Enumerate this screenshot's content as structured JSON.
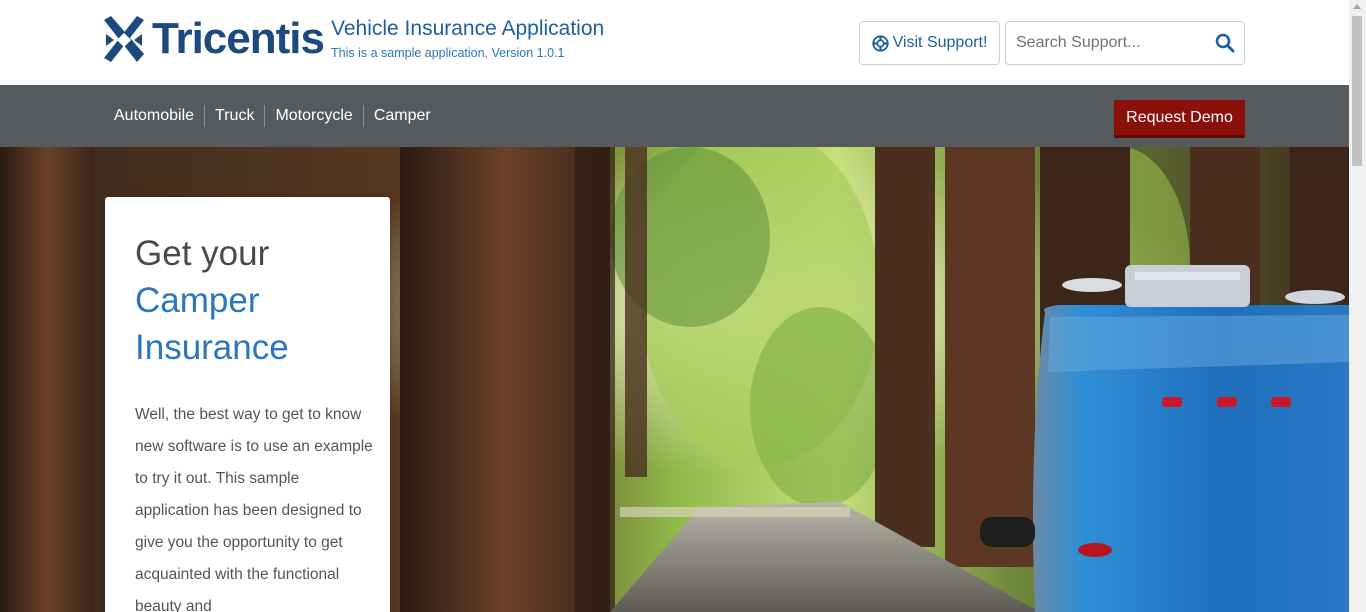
{
  "header": {
    "logo_text": "Tricentis",
    "app_title": "Vehicle Insurance Application",
    "app_subtitle": "This is a sample application, Version 1.0.1",
    "support_label": "Visit Support!",
    "search_placeholder": "Search Support...",
    "search_value": ""
  },
  "nav": {
    "items": [
      {
        "label": "Automobile"
      },
      {
        "label": "Truck"
      },
      {
        "label": "Motorcycle"
      },
      {
        "label": "Camper"
      }
    ],
    "demo_label": "Request Demo"
  },
  "hero": {
    "heading_line1": "Get your",
    "heading_line2": "Camper",
    "heading_line3": "Insurance",
    "body": "Well, the best way to get to know new software is to use an example to try it out. This sample application has been designed to give you the opportunity to get acquainted with the functional beauty and"
  },
  "icons": {
    "logo": "tricentis-x-logo",
    "support": "lifebuoy-icon",
    "search": "magnifier-icon"
  },
  "colors": {
    "brand_blue": "#1d4a7e",
    "link_blue": "#2c77bb",
    "nav_bg": "#565a5f",
    "demo_red": "#8b1009"
  }
}
